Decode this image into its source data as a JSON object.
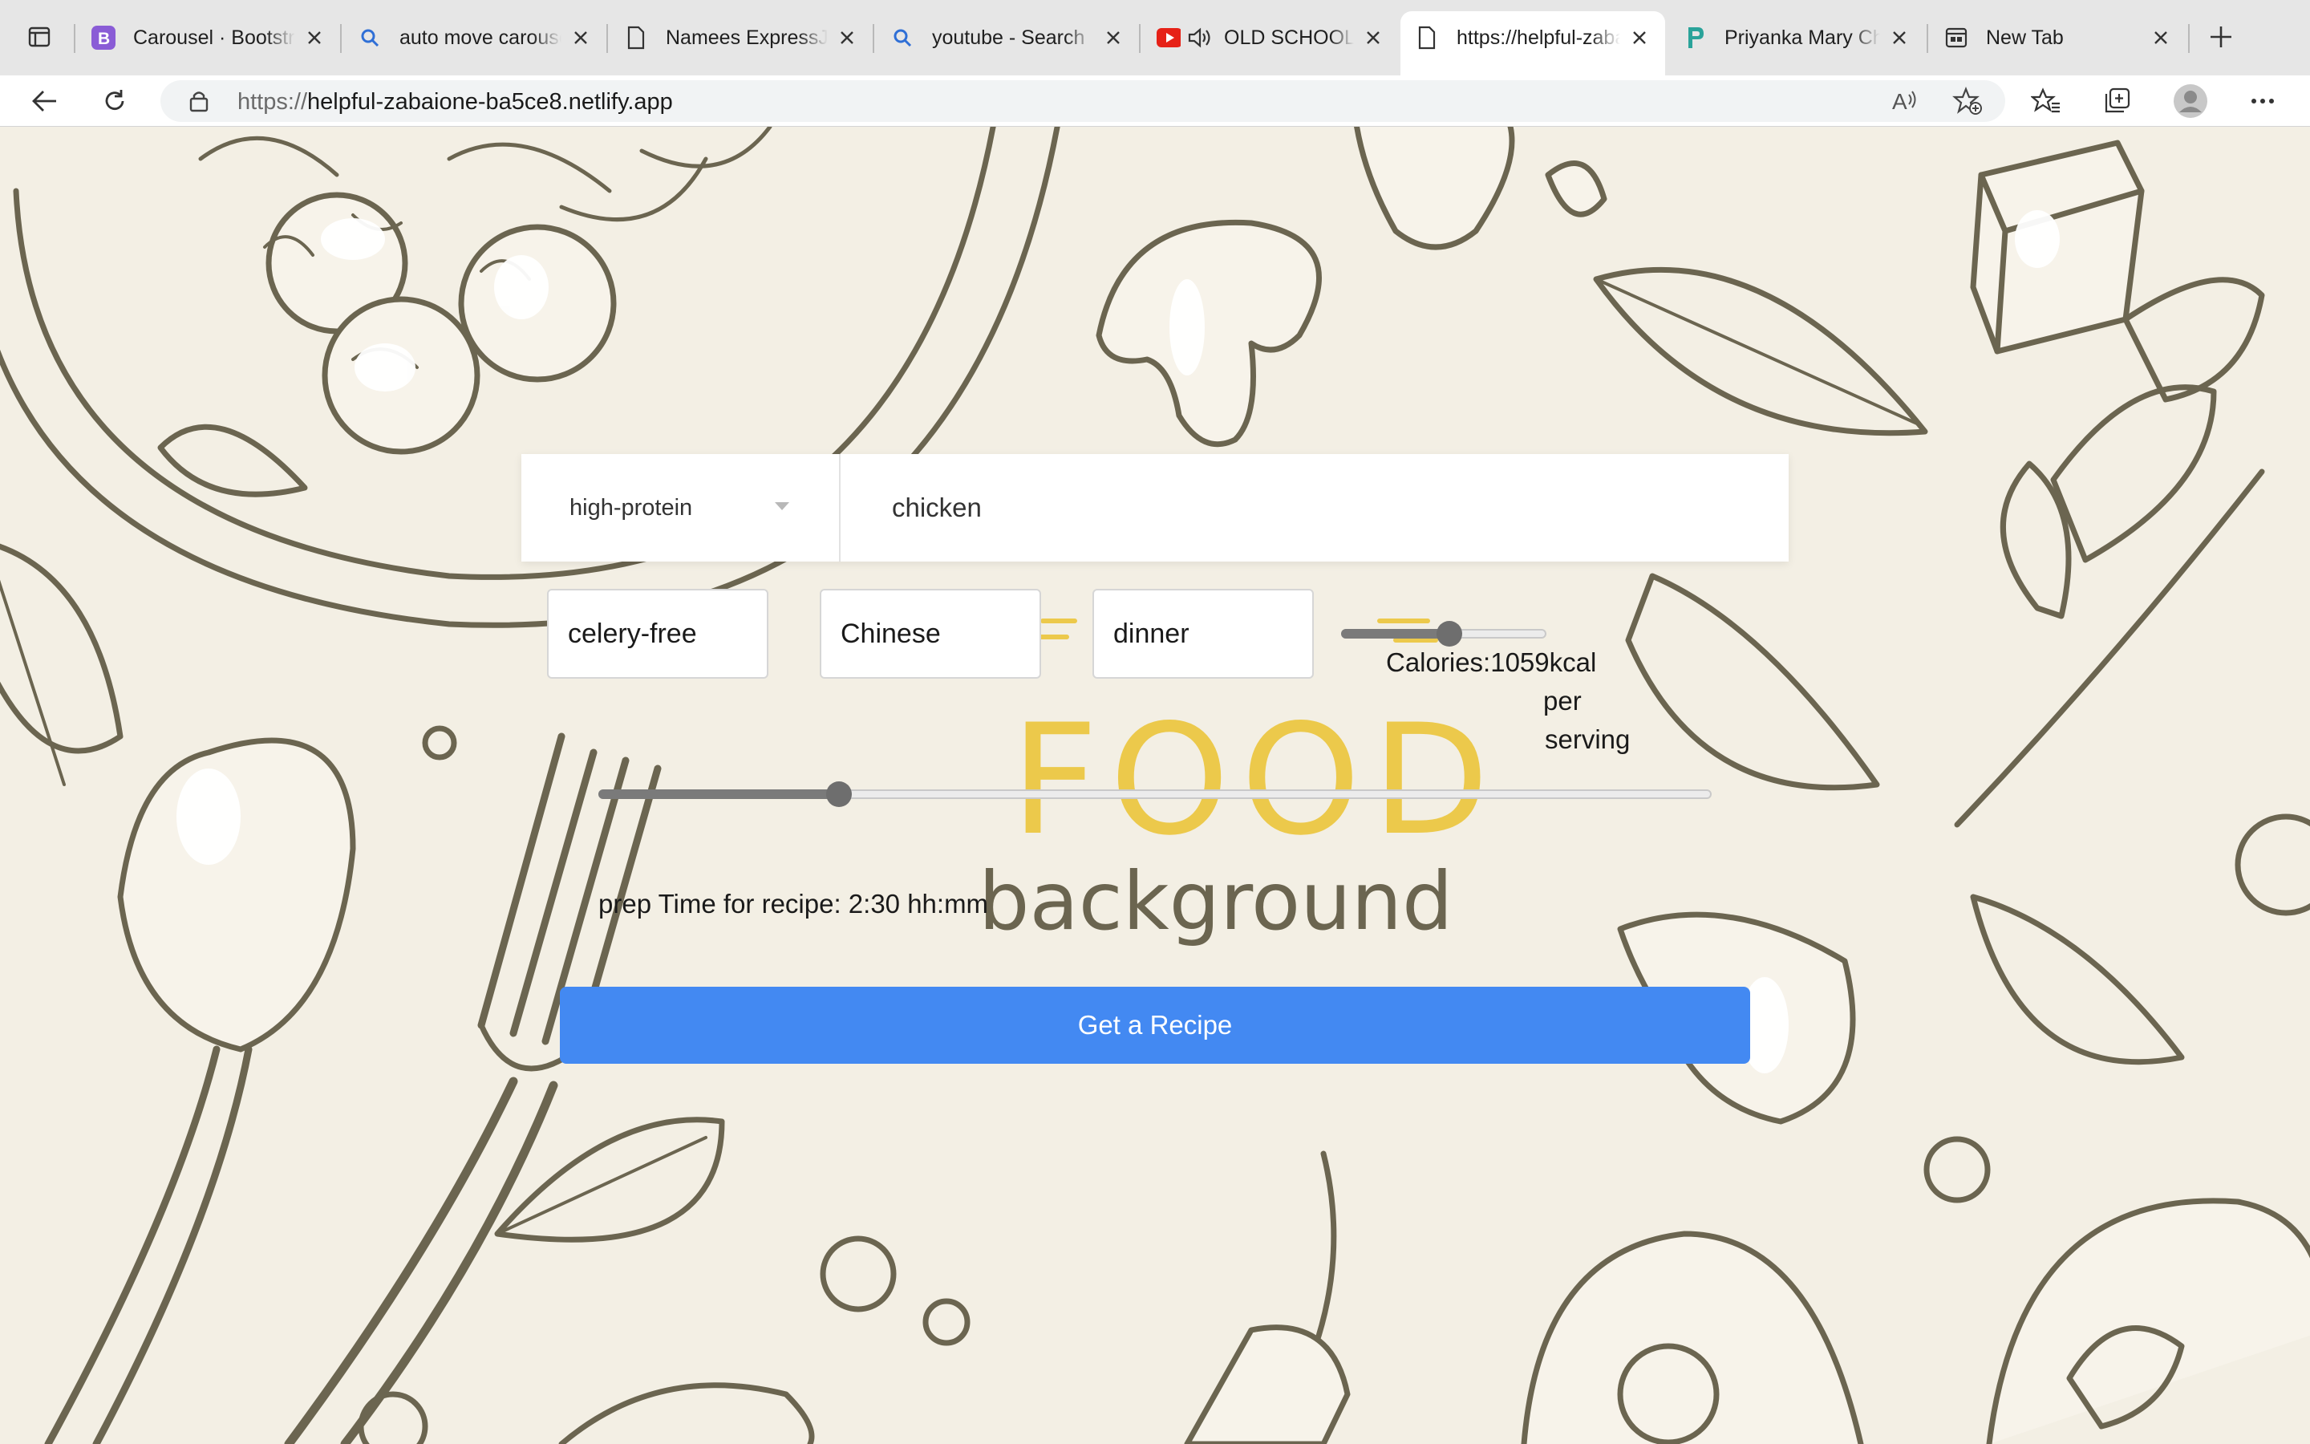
{
  "browser": {
    "tabs": [
      {
        "title": "Carousel · Bootstrap",
        "icon": "bootstrap-icon",
        "active": false
      },
      {
        "title": "auto move carousel",
        "icon": "search-icon",
        "active": false
      },
      {
        "title": "Namees ExpressJS",
        "icon": "document-icon",
        "active": false
      },
      {
        "title": "youtube - Search",
        "icon": "search-icon",
        "active": false
      },
      {
        "title": "OLD SCHOOL",
        "icon": "youtube-icon",
        "active": false
      },
      {
        "title": "https://helpful-zabaione",
        "icon": "document-icon",
        "active": true
      },
      {
        "title": "Priyanka Mary Ch",
        "icon": "netlify-icon",
        "active": false
      },
      {
        "title": "New Tab",
        "icon": "newtab-icon",
        "active": false
      }
    ],
    "address": {
      "scheme": "https://",
      "host": "helpful-zabaione-ba5ce8.netlify.app"
    }
  },
  "page": {
    "health_select": {
      "value": "high-protein"
    },
    "query": {
      "value": "chicken"
    },
    "filters": {
      "allergy": "celery-free",
      "cuisine": "Chinese",
      "meal_type": "dinner"
    },
    "calories": {
      "label_line1": "Calories:1059kcal",
      "label_line2": "per",
      "label_line3": "serving",
      "slider_fraction": 0.52
    },
    "prep_time": {
      "label": "prep Time for recipe: 2:30 hh:mm",
      "slider_fraction": 0.215
    },
    "background": {
      "word1": "FOOD",
      "word2": "background"
    },
    "submit_label": "Get a Recipe",
    "colors": {
      "accent": "#4389f2",
      "ink": "#6b6550",
      "paper": "#f3efe4",
      "yellow": "#ecc94b"
    }
  }
}
